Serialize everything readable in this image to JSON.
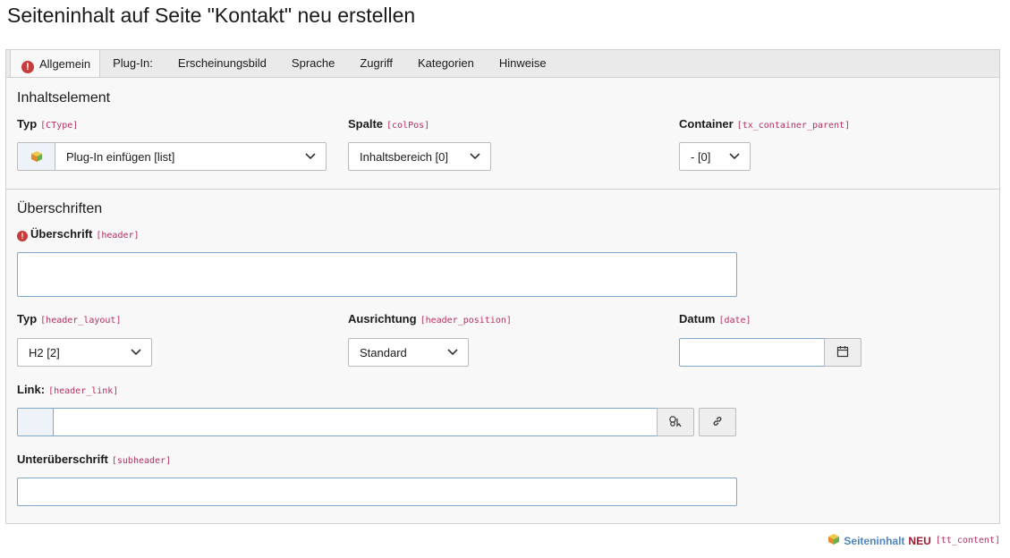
{
  "page": {
    "title": "Seiteninhalt auf Seite \"Kontakt\" neu erstellen"
  },
  "tabs": [
    {
      "label": "Allgemein",
      "active": true,
      "has_error": true
    },
    {
      "label": "Plug-In:"
    },
    {
      "label": "Erscheinungsbild"
    },
    {
      "label": "Sprache"
    },
    {
      "label": "Zugriff"
    },
    {
      "label": "Kategorien"
    },
    {
      "label": "Hinweise"
    }
  ],
  "sections": {
    "content_element": {
      "title": "Inhaltselement",
      "type": {
        "label": "Typ",
        "code": "[CType]",
        "value": "Plug-In einfügen [list]"
      },
      "column": {
        "label": "Spalte",
        "code": "[colPos]",
        "value": "Inhaltsbereich [0]"
      },
      "container": {
        "label": "Container",
        "code": "[tx_container_parent]",
        "value": "- [0]"
      }
    },
    "headers": {
      "title": "Überschriften",
      "header": {
        "label": "Überschrift",
        "code": "[header]",
        "value": ""
      },
      "layout": {
        "label": "Typ",
        "code": "[header_layout]",
        "value": "H2 [2]"
      },
      "position": {
        "label": "Ausrichtung",
        "code": "[header_position]",
        "value": "Standard"
      },
      "date": {
        "label": "Datum",
        "code": "[date]",
        "value": ""
      },
      "link": {
        "label": "Link:",
        "code": "[header_link]",
        "value": ""
      },
      "subheader": {
        "label": "Unterüberschrift",
        "code": "[subheader]",
        "value": ""
      }
    }
  },
  "footer": {
    "name": "Seiteninhalt",
    "status": "NEU",
    "code": "[tt_content]"
  },
  "colors": {
    "error": "#c83c3c",
    "code": "#b7305a",
    "link": "#4c85c2",
    "new": "#a3152f",
    "input_border": "#7fa7cf"
  },
  "icons": [
    "error-icon",
    "cube-icon",
    "chevron-down-icon",
    "calendar-icon",
    "link-browser-icon",
    "link-icon"
  ]
}
